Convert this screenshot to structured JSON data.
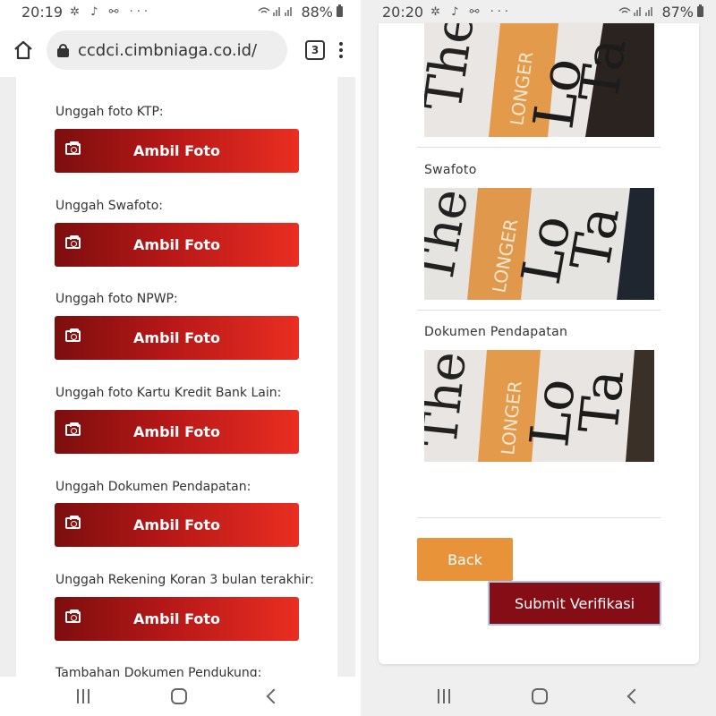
{
  "left": {
    "status": {
      "time": "20:19",
      "notif_icons": "✲ ♪ ⚯ ···",
      "battery": "88%"
    },
    "browser": {
      "url": "ccdci.cimbniaga.co.id/",
      "tab_count": "3"
    },
    "uploads": [
      {
        "label": "Unggah foto KTP:",
        "button": "Ambil Foto"
      },
      {
        "label": "Unggah Swafoto:",
        "button": "Ambil Foto"
      },
      {
        "label": "Unggah foto NPWP:",
        "button": "Ambil Foto"
      },
      {
        "label": "Unggah foto Kartu Kredit Bank Lain:",
        "button": "Ambil Foto"
      },
      {
        "label": "Unggah Dokumen Pendapatan:",
        "button": "Ambil Foto"
      },
      {
        "label": "Unggah Rekening Koran 3 bulan terakhir:",
        "button": "Ambil Foto"
      }
    ],
    "extra_label": "Tambahan Dokumen Pendukung:"
  },
  "right": {
    "status": {
      "time": "20:20",
      "notif_icons": "✲ ♪ ⚯ ···",
      "battery": "87%"
    },
    "sections": [
      {
        "label": "Swafoto"
      },
      {
        "label": "Dokumen Pendapatan"
      }
    ],
    "back_label": "Back",
    "submit_label": "Submit Verifikasi"
  },
  "colors": {
    "primary_red": "#b51717",
    "dark_red": "#850d15",
    "orange": "#e8923a"
  }
}
